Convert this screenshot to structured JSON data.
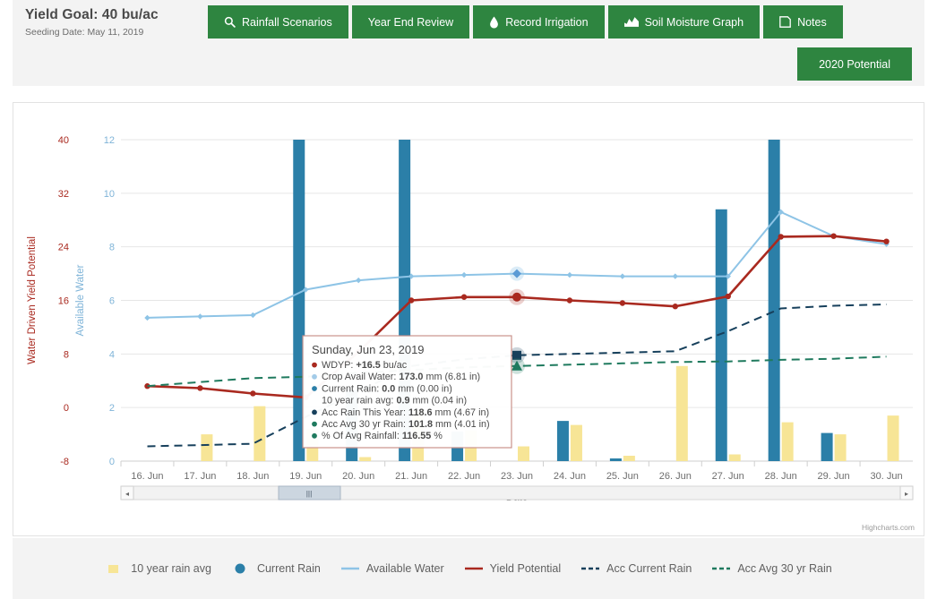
{
  "header": {
    "title": "Yield Goal: 40 bu/ac",
    "subtitle": "Seeding Date: May 11, 2019",
    "buttons": [
      {
        "label": "Rainfall Scenarios",
        "icon": "search-icon"
      },
      {
        "label": "Year End Review",
        "icon": "none"
      },
      {
        "label": "Record Irrigation",
        "icon": "water-drop-icon"
      },
      {
        "label": "Soil Moisture Graph",
        "icon": "area-chart-icon"
      },
      {
        "label": "Notes",
        "icon": "note-icon"
      }
    ],
    "secondary_button": {
      "label": "2020 Potential"
    }
  },
  "chart_credit": "Highcharts.com",
  "navigator": {
    "left_arrow": "◂",
    "right_arrow": "▸",
    "handle": "|||"
  },
  "tooltip": {
    "title": "Sunday, Jun 23, 2019",
    "rows": [
      {
        "marker": "circle",
        "color": "#a9291f",
        "label": "WDYP:",
        "value": "+16.5",
        "unit": " bu/ac"
      },
      {
        "marker": "circle",
        "color": "#a3cbe8",
        "label": "Crop Avail Water:",
        "value": "173.0",
        "unit": " mm (6.81 in)"
      },
      {
        "marker": "circle",
        "color": "#2b7fa8",
        "label": "Current Rain:",
        "value": "0.0",
        "unit": " mm (0.00 in)"
      },
      {
        "marker": "none",
        "color": "#f5e49a",
        "label": "10 year rain avg:",
        "value": "0.9",
        "unit": " mm (0.04 in)"
      },
      {
        "marker": "circle",
        "color": "#17405c",
        "label": "Acc Rain This Year:",
        "value": "118.6",
        "unit": " mm (4.67 in)"
      },
      {
        "marker": "circle",
        "color": "#1f7a5e",
        "label": "Acc Avg 30 yr Rain:",
        "value": "101.8",
        "unit": " mm (4.01 in)"
      },
      {
        "marker": "circle",
        "color": "#1f7a5e",
        "label": "% Of Avg Rainfall:",
        "value": "116.55",
        "unit": " %"
      }
    ]
  },
  "legend": [
    {
      "label": "10 year rain avg",
      "type": "square",
      "color": "#f7e596"
    },
    {
      "label": "Current Rain",
      "type": "circle",
      "color": "#2b7fa8"
    },
    {
      "label": "Available Water",
      "type": "line",
      "color": "#8ec4e6"
    },
    {
      "label": "Yield Potential",
      "type": "line",
      "color": "#a9291f"
    },
    {
      "label": "Acc Current Rain",
      "type": "dashed",
      "color": "#17405c"
    },
    {
      "label": "Acc Avg 30 yr Rain",
      "type": "dashed",
      "color": "#1f7a5e"
    }
  ],
  "chart_data": {
    "type": "line",
    "title": "",
    "xlabel": "Date",
    "grid": true,
    "legend_position": "bottom",
    "categories": [
      "16. Jun",
      "17. Jun",
      "18. Jun",
      "19. Jun",
      "20. Jun",
      "21. Jun",
      "22. Jun",
      "23. Jun",
      "24. Jun",
      "25. Jun",
      "26. Jun",
      "27. Jun",
      "28. Jun",
      "29. Jun",
      "30. Jun"
    ],
    "axes": {
      "left": {
        "label": "Water Driven Yield Potential",
        "ticks": [
          40,
          32,
          24,
          16,
          8,
          0,
          -8
        ],
        "range": [
          -8,
          40
        ],
        "color": "#a9291f"
      },
      "right_inner": {
        "label": "Available Water",
        "ticks": [
          12,
          10,
          8,
          6,
          4,
          2,
          0
        ],
        "range": [
          0,
          12
        ],
        "color": "#7fb4d8"
      }
    },
    "series": [
      {
        "name": "10 year rain avg",
        "type": "column",
        "axis": "right_inner",
        "color": "#f7e596",
        "values": [
          0.0,
          1.0,
          2.05,
          1.2,
          0.15,
          1.9,
          1.15,
          0.55,
          1.35,
          0.2,
          3.55,
          0.25,
          1.45,
          1.0,
          1.7
        ]
      },
      {
        "name": "Current Rain",
        "type": "column",
        "axis": "right_inner",
        "color": "#2b7fa8",
        "values": [
          0.0,
          0.0,
          0.0,
          12.0,
          2.65,
          12.0,
          1.1,
          0.0,
          1.5,
          0.1,
          0.0,
          9.4,
          12.0,
          1.05,
          0.0
        ]
      },
      {
        "name": "Available Water",
        "type": "line",
        "axis": "right_inner",
        "color": "#8ec4e6",
        "values": [
          5.35,
          5.4,
          5.45,
          6.4,
          6.75,
          6.9,
          6.95,
          7.0,
          6.95,
          6.9,
          6.9,
          6.9,
          9.3,
          8.4,
          8.1
        ]
      },
      {
        "name": "Yield Potential",
        "type": "line",
        "axis": "left",
        "color": "#a9291f",
        "values": [
          3.2,
          2.9,
          2.1,
          1.5,
          8.3,
          16.0,
          16.5,
          16.5,
          16.0,
          15.6,
          15.1,
          16.6,
          25.5,
          25.6,
          24.8
        ]
      },
      {
        "name": "Acc Current Rain",
        "type": "line-dashed",
        "axis": "right_inner",
        "color": "#17405c",
        "values": [
          0.55,
          0.6,
          0.65,
          1.65,
          2.6,
          3.55,
          3.8,
          3.95,
          4.0,
          4.05,
          4.1,
          4.85,
          5.7,
          5.8,
          5.85
        ]
      },
      {
        "name": "Acc Avg 30 yr Rain",
        "type": "line-dashed",
        "axis": "right_inner",
        "color": "#1f7a5e",
        "values": [
          2.8,
          2.95,
          3.1,
          3.15,
          3.3,
          3.4,
          3.5,
          3.55,
          3.6,
          3.65,
          3.7,
          3.72,
          3.78,
          3.82,
          3.9
        ]
      }
    ],
    "highlighted_point": "23. Jun"
  }
}
